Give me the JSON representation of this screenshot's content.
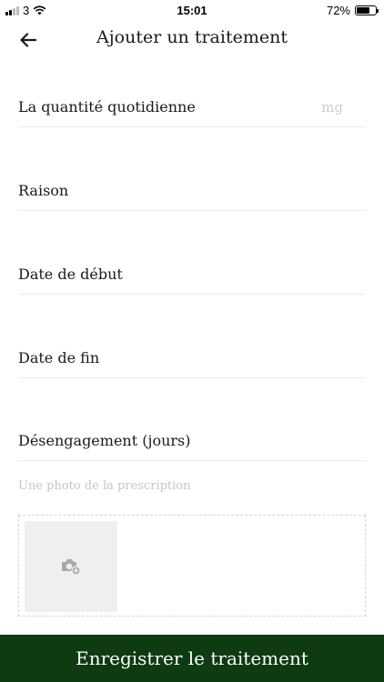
{
  "status_bar": {
    "carrier": "3",
    "time": "15:01",
    "battery_percent": "72%",
    "battery_level": 0.72,
    "icons": [
      "signal-icon",
      "wifi-icon",
      "battery-icon"
    ]
  },
  "header": {
    "title": "Ajouter un traitement",
    "back_icon": "arrow-left-icon"
  },
  "form": {
    "daily_quantity": {
      "label": "La quantité quotidienne",
      "unit": "mg"
    },
    "reason": {
      "label": "Raison"
    },
    "start_date": {
      "label": "Date de début"
    },
    "end_date": {
      "label": "Date de fin"
    },
    "disengagement": {
      "label": "Désengagement (jours)"
    },
    "photo": {
      "label": "Une photo de la prescription",
      "icon": "camera-add-icon"
    }
  },
  "save_button": {
    "label": "Enregistrer le traitement"
  },
  "colors": {
    "primary": "#0e3b12",
    "text": "#1a1a1a",
    "muted": "#c6c6c6",
    "divider": "#ececec"
  }
}
